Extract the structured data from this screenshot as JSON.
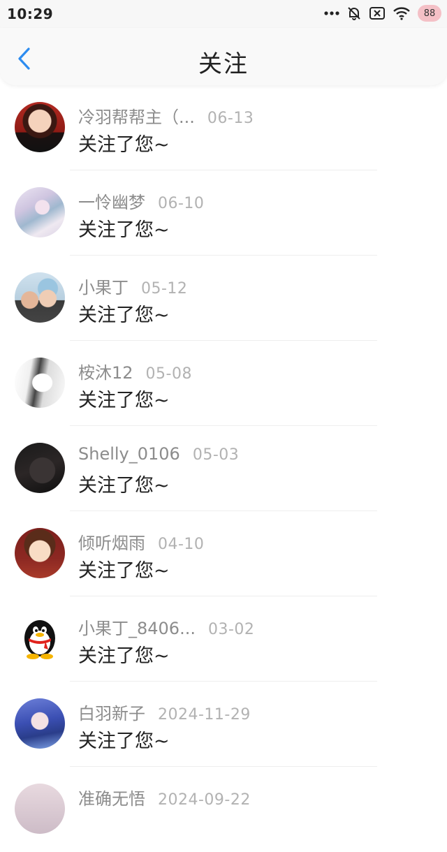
{
  "status_bar": {
    "time": "10:29",
    "icons": [
      "more-dots-icon",
      "bell-muted-icon",
      "sim-x-icon",
      "wifi-icon",
      "battery-icon"
    ],
    "battery_level": "88",
    "battery_color": "#f4c0c6"
  },
  "header": {
    "title": "关注",
    "back_icon": "chevron-left-icon",
    "back_icon_color": "#2d8cf0"
  },
  "notifications": [
    {
      "name": "冷羽帮帮主（...",
      "date": "06-13",
      "message": "关注了您~"
    },
    {
      "name": "一怜幽梦",
      "date": "06-10",
      "message": "关注了您~"
    },
    {
      "name": "小果丁",
      "date": "05-12",
      "message": "关注了您~"
    },
    {
      "name": "桉沐12",
      "date": "05-08",
      "message": "关注了您~"
    },
    {
      "name": "Shelly_0106",
      "date": "05-03",
      "message": "关注了您~"
    },
    {
      "name": "倾听烟雨",
      "date": "04-10",
      "message": "关注了您~"
    },
    {
      "name": "小果丁_8406...",
      "date": "03-02",
      "message": "关注了您~"
    },
    {
      "name": "白羽新子",
      "date": "2024-11-29",
      "message": "关注了您~"
    },
    {
      "name": "准确无悟",
      "date": "2024-09-22",
      "message": ""
    }
  ]
}
